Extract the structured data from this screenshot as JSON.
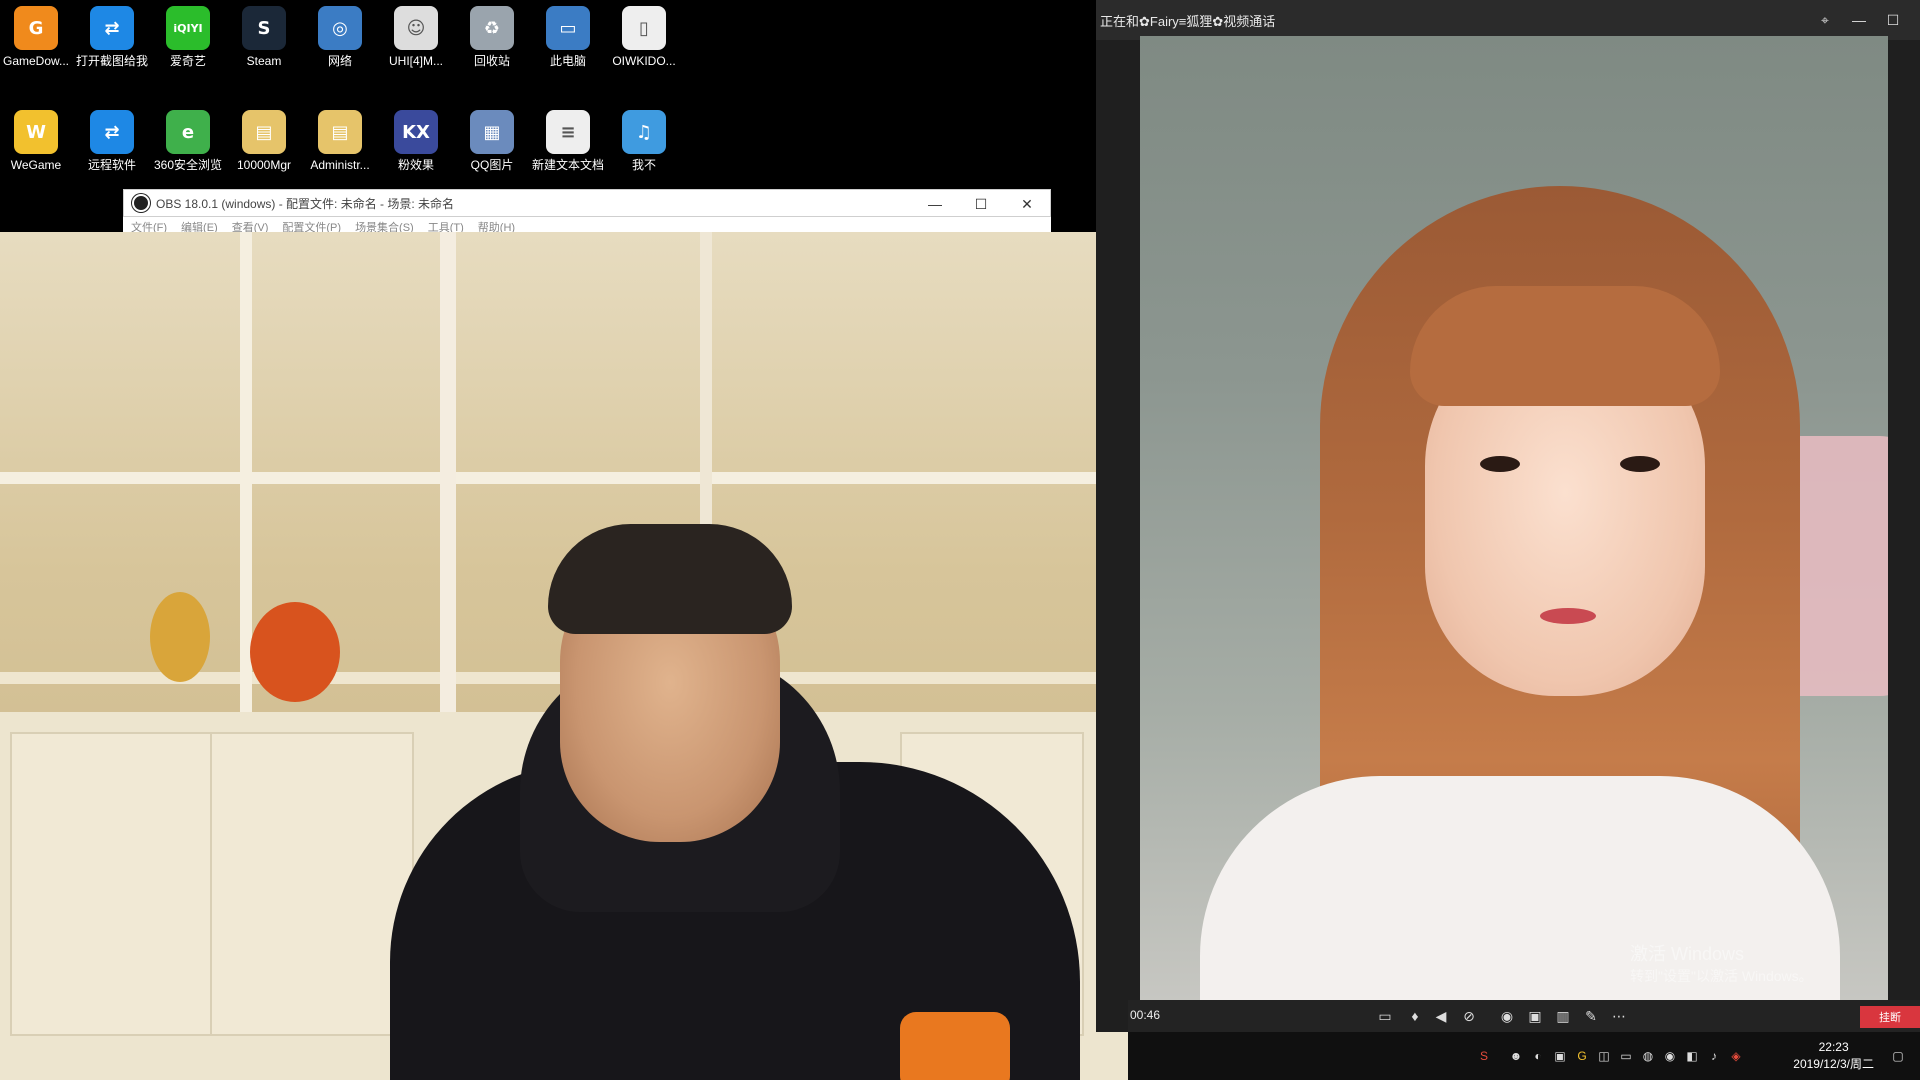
{
  "desktop": {
    "icons_row1": [
      {
        "label": "GameDow...",
        "glyph": "G",
        "color": "#f08a1c"
      },
      {
        "label": "打开截图给我",
        "glyph": "⇄",
        "color": "#1e88e5"
      },
      {
        "label": "爱奇艺",
        "glyph": "iQIYI",
        "color": "#2bbd2b"
      },
      {
        "label": "Steam",
        "glyph": "S",
        "color": "#1b2838"
      },
      {
        "label": "网络",
        "glyph": "◎",
        "color": "#3b7cc4"
      },
      {
        "label": "UHI[4]M...",
        "glyph": "☺",
        "color": "#dddddd"
      },
      {
        "label": "回收站",
        "glyph": "♻",
        "color": "#9aa4ad"
      },
      {
        "label": "此电脑",
        "glyph": "▭",
        "color": "#3b7cc4"
      },
      {
        "label": "OIWKIDO...",
        "glyph": "▯",
        "color": "#eeeeee"
      }
    ],
    "icons_row2": [
      {
        "label": "WeGame",
        "glyph": "W",
        "color": "#f2c12e"
      },
      {
        "label": "远程软件",
        "glyph": "⇄",
        "color": "#1e88e5"
      },
      {
        "label": "360安全浏览",
        "glyph": "e",
        "color": "#3fb04b"
      },
      {
        "label": "10000Mgr",
        "glyph": "▤",
        "color": "#e6c46a"
      },
      {
        "label": "Administr...",
        "glyph": "▤",
        "color": "#e6c46a"
      },
      {
        "label": "粉效果",
        "glyph": "KX",
        "color": "#3a4a9c"
      },
      {
        "label": "QQ图片",
        "glyph": "▦",
        "color": "#6b8bbd"
      },
      {
        "label": "新建文本文档",
        "glyph": "≡",
        "color": "#eeeeee"
      },
      {
        "label": "我不",
        "glyph": "♫",
        "color": "#3f9be0"
      }
    ]
  },
  "obs": {
    "title": "OBS 18.0.1 (windows) - 配置文件: 未命名 - 场景: 未命名",
    "menu": [
      "文件(F)",
      "编辑(E)",
      "查看(V)",
      "配置文件(P)",
      "场景集合(S)",
      "工具(T)",
      "帮助(H)"
    ]
  },
  "call": {
    "title": "正在和✿Fairy≡狐狸✿视频通话",
    "timer": "00:46",
    "hangup": "挂断",
    "watermark_line1": "激活 Windows",
    "watermark_line2": "转到\"设置\"以激活 Windows。"
  },
  "taskbar": {
    "time": "22:23",
    "date": "2019/12/3/周二"
  }
}
